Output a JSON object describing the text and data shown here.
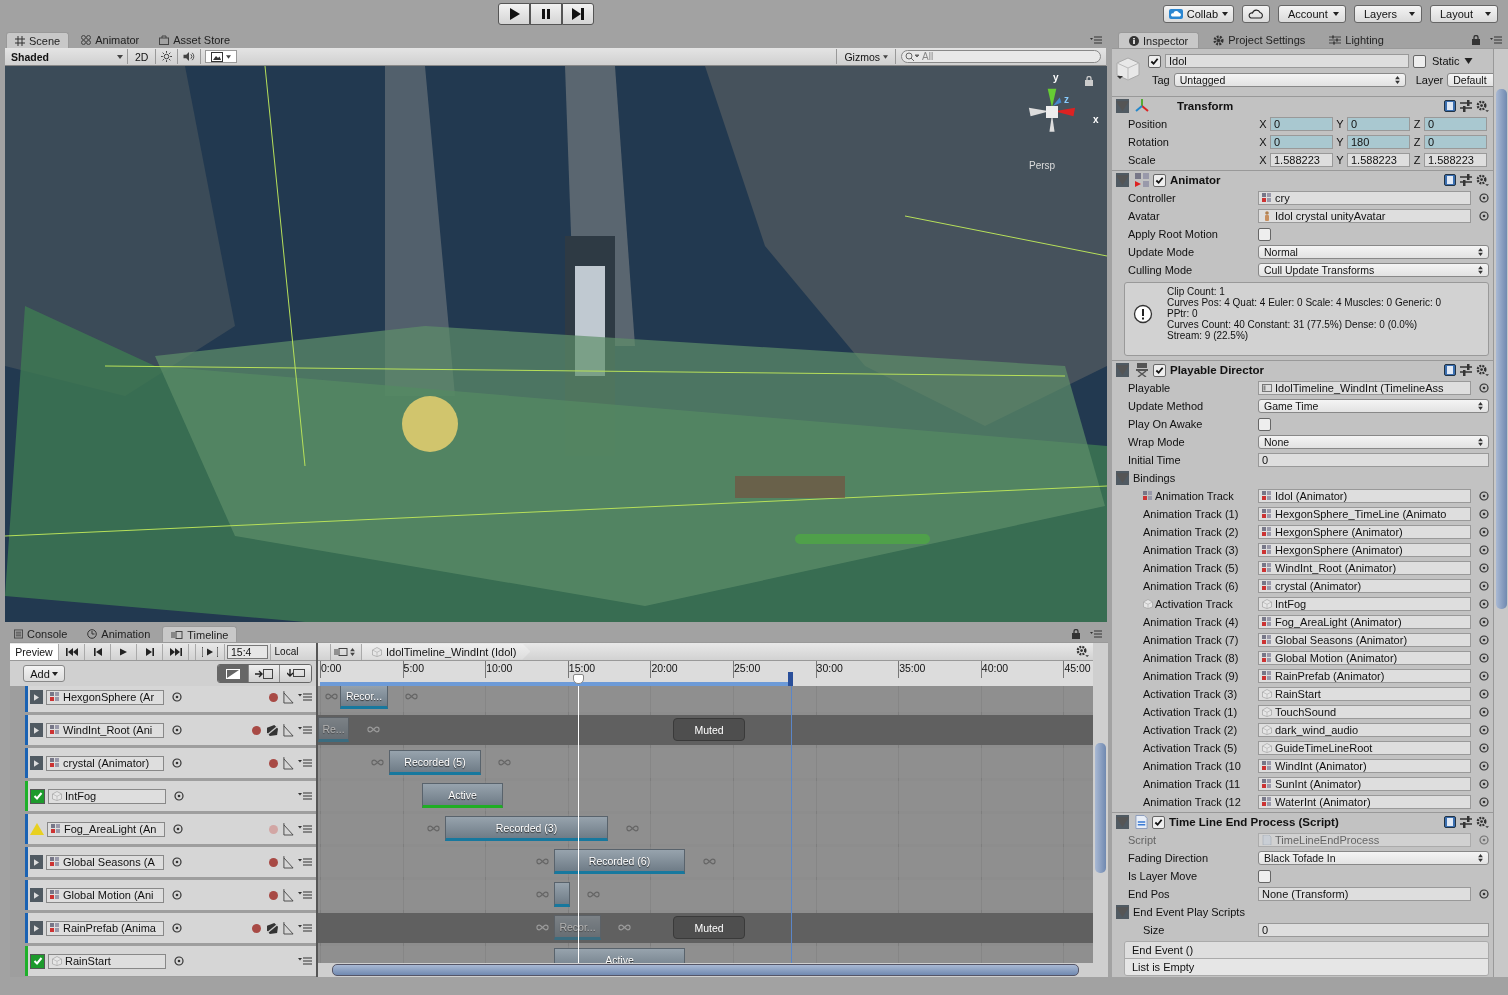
{
  "toolbar": {
    "buttons": [
      {
        "label": "Collab",
        "kind": "collab"
      },
      {
        "kind": "cloud"
      },
      {
        "label": "Account",
        "kind": "menu"
      },
      {
        "label": "Layers",
        "kind": "menu"
      },
      {
        "label": "Layout",
        "kind": "menu"
      }
    ]
  },
  "scene_panel": {
    "tabs": [
      {
        "label": "Scene",
        "selected": true
      },
      {
        "label": "Animator",
        "selected": false
      },
      {
        "label": "Asset Store",
        "selected": false
      }
    ],
    "shading": "Shaded",
    "mode_2d": "2D",
    "lighting_on": false,
    "audio_on": false,
    "gizmos": "Gizmos",
    "search_placeholder": "All",
    "axes": [
      "y",
      "z",
      "x"
    ],
    "projection": "Persp"
  },
  "bottom_panel": {
    "tabs": [
      {
        "label": "Console",
        "selected": false
      },
      {
        "label": "Animation",
        "selected": false
      },
      {
        "label": "Timeline",
        "selected": true
      }
    ]
  },
  "timeline": {
    "preview": {
      "label": "Preview",
      "on": true
    },
    "frame": "15:4",
    "space": "Local",
    "add": "Add",
    "breadcrumb": "IdolTimeline_WindInt (Idol)",
    "modes": [
      {
        "selected": true
      },
      {
        "selected": false
      },
      {
        "selected": false
      }
    ],
    "ruler": [
      "0:00",
      "5:00",
      "10:00",
      "15:00",
      "20:00",
      "25:00",
      "30:00",
      "35:00",
      "40:00",
      "45:00"
    ],
    "tracks": [
      {
        "kind": "animation",
        "binding": "HexgonSphere (Ar",
        "muted": false,
        "warning": false,
        "clips": [
          {
            "kind": "animation",
            "label": "Recor..."
          }
        ]
      },
      {
        "kind": "animation",
        "binding": "WindInt_Root (Ani",
        "muted": true,
        "warning": false,
        "muted_label": "Muted",
        "clips": [
          {
            "kind": "animation",
            "label": "Re..."
          }
        ]
      },
      {
        "kind": "animation",
        "binding": "crystal (Animator)",
        "muted": false,
        "warning": false,
        "clips": [
          {
            "kind": "animation",
            "label": "Recorded (5)"
          }
        ]
      },
      {
        "kind": "activation",
        "binding": "IntFog",
        "enabled": true,
        "clips": [
          {
            "kind": "activation",
            "label": "Active"
          }
        ]
      },
      {
        "kind": "animation",
        "binding": "Fog_AreaLight (An",
        "muted": false,
        "warning": true,
        "clips": [
          {
            "kind": "animation",
            "label": "Recorded (3)"
          }
        ]
      },
      {
        "kind": "animation",
        "binding": "Global Seasons (A",
        "muted": false,
        "warning": false,
        "clips": [
          {
            "kind": "animation",
            "label": "Recorded (6)"
          }
        ]
      },
      {
        "kind": "animation",
        "binding": "Global Motion (Ani",
        "muted": false,
        "warning": false,
        "clips": [
          {
            "kind": "animation"
          }
        ]
      },
      {
        "kind": "animation",
        "binding": "RainPrefab (Anima",
        "muted": true,
        "warning": false,
        "muted_label": "Muted",
        "clips": [
          {
            "kind": "animation",
            "label": "Recor..."
          }
        ]
      },
      {
        "kind": "activation",
        "binding": "RainStart",
        "enabled": true,
        "clips": [
          {
            "kind": "activation",
            "label": "Active"
          }
        ]
      }
    ]
  },
  "inspector": {
    "tabs": [
      {
        "label": "Inspector",
        "selected": true
      },
      {
        "label": "Project Settings",
        "selected": false
      },
      {
        "label": "Lighting",
        "selected": false
      }
    ],
    "object": {
      "active": true,
      "name": "Idol",
      "static": false,
      "static_label": "Static",
      "tag_label": "Tag",
      "tag": "Untagged",
      "layer_label": "Layer",
      "layer": "Default"
    },
    "components": [
      {
        "kind": "transform",
        "title": "Transform",
        "expanded": true,
        "rows": [
          {
            "kind": "vector",
            "label": "Position",
            "animated": true,
            "values": [
              {
                "axis": "X",
                "value": "0"
              },
              {
                "axis": "Y",
                "value": "0"
              },
              {
                "axis": "Z",
                "value": "0"
              }
            ]
          },
          {
            "kind": "vector",
            "label": "Rotation",
            "animated": true,
            "values": [
              {
                "axis": "X",
                "value": "0"
              },
              {
                "axis": "Y",
                "value": "180"
              },
              {
                "axis": "Z",
                "value": "0"
              }
            ]
          },
          {
            "kind": "vector",
            "label": "Scale",
            "animated": false,
            "values": [
              {
                "axis": "X",
                "value": "1.588223"
              },
              {
                "axis": "Y",
                "value": "1.588223"
              },
              {
                "axis": "Z",
                "value": "1.588223"
              }
            ]
          }
        ]
      },
      {
        "kind": "animator",
        "title": "Animator",
        "expanded": true,
        "enabled": true,
        "rows": [
          {
            "kind": "controller",
            "label": "Controller",
            "value": "cry"
          },
          {
            "kind": "avatar",
            "label": "Avatar",
            "value": "Idol crystal unityAvatar"
          },
          {
            "kind": "checkbox",
            "label": "Apply Root Motion",
            "checked": false
          },
          {
            "kind": "dropdown",
            "label": "Update Mode",
            "value": "Normal"
          },
          {
            "kind": "dropdown",
            "label": "Culling Mode",
            "value": "Cull Update Transforms"
          },
          {
            "kind": "info",
            "lines": [
              "Clip Count: 1",
              "Curves Pos: 4 Quat: 4 Euler: 0 Scale: 4 Muscles: 0 Generic: 0",
              "PPtr: 0",
              "Curves Count: 40 Constant: 31 (77.5%) Dense: 0 (0.0%)",
              "Stream: 9 (22.5%)"
            ]
          }
        ]
      },
      {
        "kind": "director",
        "title": "Playable Director",
        "expanded": true,
        "enabled": true,
        "rows": [
          {
            "kind": "playable",
            "label": "Playable",
            "value": "IdolTimeline_WindInt (TimelineAss"
          },
          {
            "kind": "dropdown",
            "label": "Update Method",
            "value": "Game Time"
          },
          {
            "kind": "checkbox",
            "label": "Play On Awake",
            "checked": false
          },
          {
            "kind": "dropdown",
            "label": "Wrap Mode",
            "value": "None"
          },
          {
            "kind": "text",
            "label": "Initial Time",
            "value": "0"
          },
          {
            "kind": "foldout",
            "label": "Bindings",
            "expanded": true,
            "children": [
              {
                "kind": "animation",
                "label_icon": true,
                "label": "Animation Track",
                "value": "Idol (Animator)"
              },
              {
                "kind": "animation",
                "label_icon": false,
                "label": "Animation Track (1)",
                "value": "HexgonSphere_TimeLine (Animato"
              },
              {
                "kind": "animation",
                "label_icon": false,
                "label": "Animation Track (2)",
                "value": "HexgonSphere (Animator)"
              },
              {
                "kind": "animation",
                "label_icon": false,
                "label": "Animation Track (3)",
                "value": "HexgonSphere (Animator)"
              },
              {
                "kind": "animation",
                "label_icon": false,
                "label": "Animation Track (5)",
                "value": "WindInt_Root (Animator)"
              },
              {
                "kind": "animation",
                "label_icon": false,
                "label": "Animation Track (6)",
                "value": "crystal (Animator)"
              },
              {
                "kind": "activation",
                "label_icon": true,
                "label": "Activation Track",
                "value": "IntFog"
              },
              {
                "kind": "animation",
                "label_icon": false,
                "label": "Animation Track (4)",
                "value": "Fog_AreaLight (Animator)"
              },
              {
                "kind": "animation",
                "label_icon": false,
                "label": "Animation Track (7)",
                "value": "Global Seasons (Animator)"
              },
              {
                "kind": "animation",
                "label_icon": false,
                "label": "Animation Track (8)",
                "value": "Global Motion (Animator)"
              },
              {
                "kind": "animation",
                "label_icon": false,
                "label": "Animation Track (9)",
                "value": "RainPrefab (Animator)"
              },
              {
                "kind": "activation",
                "label_icon": false,
                "label": "Activation Track (3)",
                "value": "RainStart"
              },
              {
                "kind": "activation",
                "label_icon": false,
                "label": "Activation Track (1)",
                "value": "TouchSound"
              },
              {
                "kind": "activation",
                "label_icon": false,
                "label": "Activation Track (2)",
                "value": "dark_wind_audio"
              },
              {
                "kind": "activation",
                "label_icon": false,
                "label": "Activation Track (5)",
                "value": "GuideTimeLineRoot"
              },
              {
                "kind": "animation",
                "label_icon": false,
                "label": "Animation Track (10",
                "value": "WindInt (Animator)"
              },
              {
                "kind": "animation",
                "label_icon": false,
                "label": "Animation Track (11",
                "value": "SunInt (Animator)"
              },
              {
                "kind": "animation",
                "label_icon": false,
                "label": "Animation Track (12",
                "value": "WaterInt (Animator)"
              }
            ]
          }
        ]
      },
      {
        "kind": "script",
        "title": "Time Line End Process (Script)",
        "expanded": true,
        "enabled": true,
        "rows": [
          {
            "kind": "script",
            "label": "Script",
            "value": "TimeLineEndProcess",
            "disabled": true
          },
          {
            "kind": "dropdown",
            "label": "Fading Direction",
            "value": "Black Tofade In"
          },
          {
            "kind": "checkbox",
            "label": "Is Layer Move",
            "checked": false
          },
          {
            "kind": "reference",
            "label": "End Pos",
            "value": "None (Transform)"
          },
          {
            "kind": "foldout",
            "label": "End Event Play Scripts",
            "expanded": true,
            "children": [
              {
                "kind": "text",
                "label": "Size",
                "value": "0"
              }
            ]
          },
          {
            "kind": "event",
            "title": "End Event ()",
            "empty": "List is Empty"
          }
        ]
      }
    ]
  }
}
